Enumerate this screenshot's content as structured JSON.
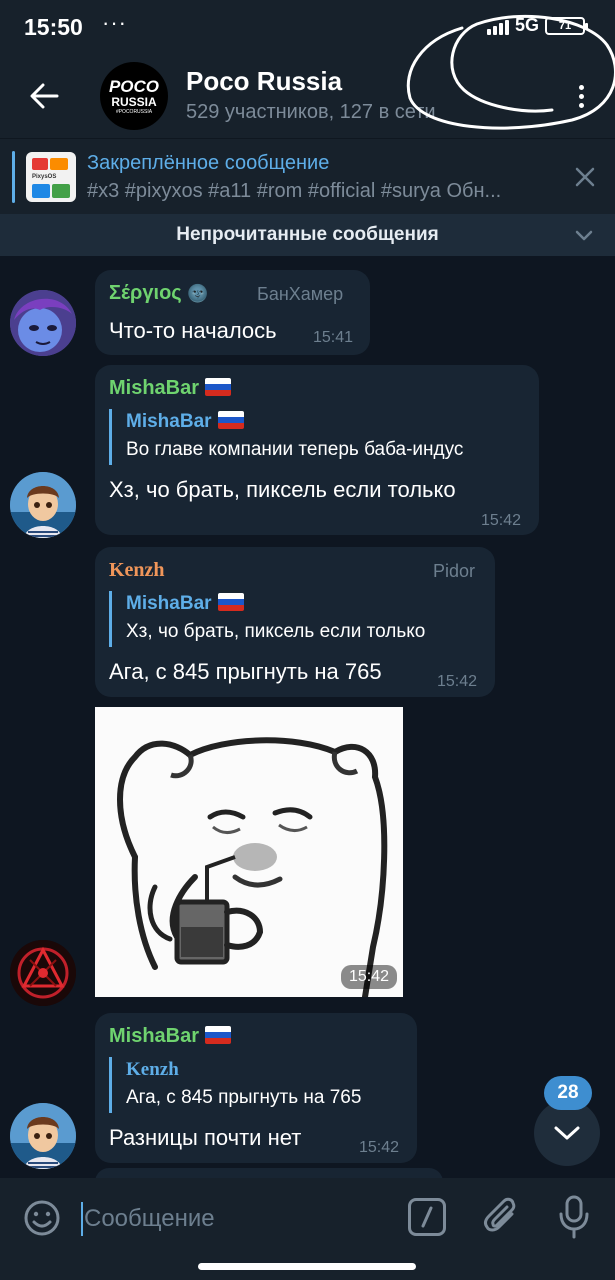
{
  "status_bar": {
    "time": "15:50",
    "dots": "···",
    "network": "5G",
    "battery": "71"
  },
  "header": {
    "avatar_line1": "POCO",
    "avatar_line2": "RUSSIA",
    "avatar_line3": "#POCORUSSIA",
    "title": "Poco Russia",
    "subtitle": "529 участников, 127 в сети"
  },
  "pinned": {
    "title": "Закреплённое сообщение",
    "text": "#x3 #pixyxos #a11 #rom #official #surya Обн...",
    "thumb_label": "PixysOS"
  },
  "unread_divider": {
    "label": "Непрочитанные сообщения"
  },
  "messages": [
    {
      "sender": "Σέργιος",
      "sender_emoji": "🌚",
      "tag": "БанХамер",
      "text": "Что-то началось",
      "time": "15:41",
      "name_color": "#6fd36f"
    },
    {
      "sender": "MishaBar",
      "reply_name": "MishaBar",
      "reply_text": "Во главе компании теперь баба-индус",
      "text": "Хз, чо брать, пиксель если только",
      "time": "15:42",
      "name_color": "#6fd36f"
    },
    {
      "sender": "Kenzh",
      "tag": "Pidor",
      "reply_name": "MishaBar",
      "reply_text": "Хз, чо брать, пиксель если только",
      "text": "Ага, с 845 прыгнуть на 765",
      "time": "15:42",
      "name_color": "#f0965a"
    },
    {
      "type": "sticker",
      "time": "15:42"
    },
    {
      "sender": "MishaBar",
      "reply_name": "Kenzh",
      "reply_text": "Ага, с 845 прыгнуть на 765",
      "text": "Разницы почти нет",
      "time": "15:42",
      "name_color": "#6fd36f"
    }
  ],
  "scroll": {
    "unread_count": "28"
  },
  "composer": {
    "placeholder": "Сообщение"
  },
  "colors": {
    "accent": "#5eaee8",
    "background": "#0e1621",
    "bubble": "#182533",
    "panel": "#17212b"
  }
}
